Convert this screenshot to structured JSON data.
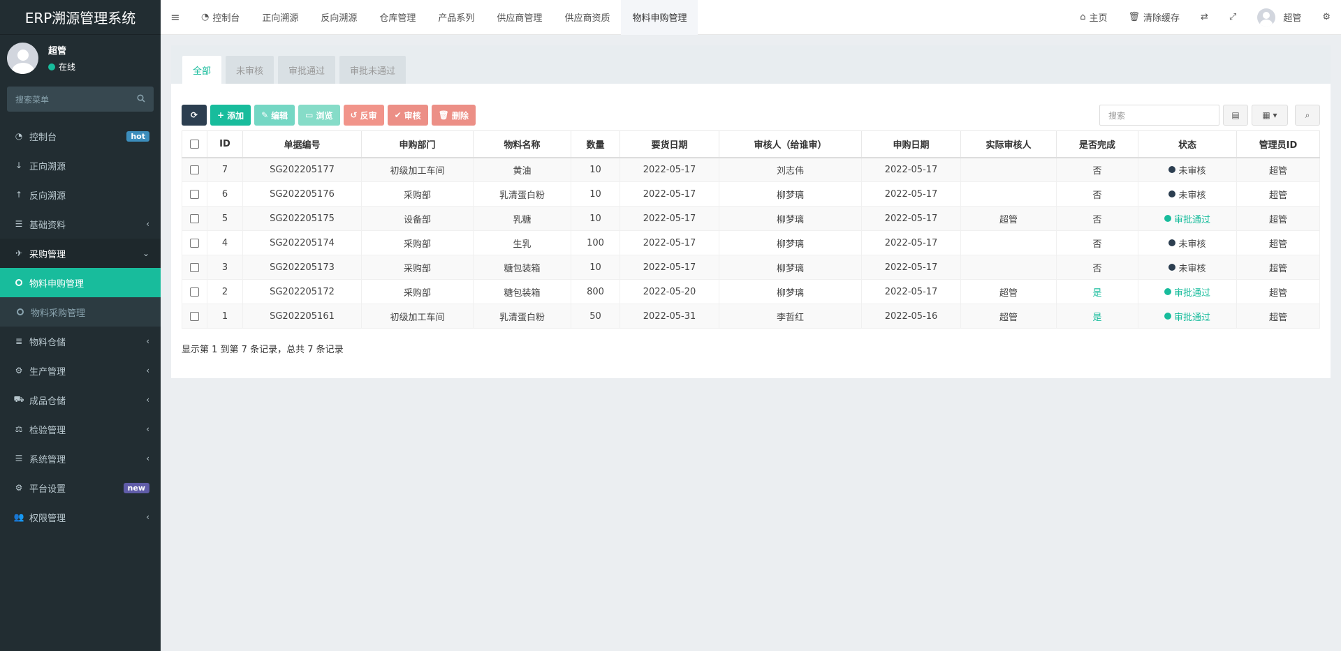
{
  "brand": "ERP溯源管理系统",
  "user": {
    "name": "超管",
    "status": "在线"
  },
  "sidebar": {
    "search_placeholder": "搜索菜单",
    "items": [
      {
        "label": "控制台",
        "icon": "dashboard-icon",
        "badge": "hot"
      },
      {
        "label": "正向溯源",
        "icon": "arrow-down-icon"
      },
      {
        "label": "反向溯源",
        "icon": "arrow-up-icon"
      },
      {
        "label": "基础资料",
        "icon": "list-icon"
      },
      {
        "label": "采购管理",
        "icon": "plane-icon"
      },
      {
        "label": "物料申购管理",
        "icon": "circle-icon"
      },
      {
        "label": "物料采购管理",
        "icon": "circle-icon"
      },
      {
        "label": "物料仓储",
        "icon": "database-icon"
      },
      {
        "label": "生产管理",
        "icon": "cogs-icon"
      },
      {
        "label": "成品仓储",
        "icon": "road-icon"
      },
      {
        "label": "检验管理",
        "icon": "balance-icon"
      },
      {
        "label": "系统管理",
        "icon": "list-icon"
      },
      {
        "label": "平台设置",
        "icon": "cogs-icon",
        "badge": "new"
      },
      {
        "label": "权限管理",
        "icon": "users-icon"
      }
    ]
  },
  "topnav": {
    "tabs": [
      "控制台",
      "正向溯源",
      "反向溯源",
      "仓库管理",
      "产品系列",
      "供应商管理",
      "供应商资质",
      "物料申购管理"
    ],
    "home": "主页",
    "clear_cache": "清除缓存",
    "username": "超管"
  },
  "panel_tabs": [
    "全部",
    "未审核",
    "审批通过",
    "审批未通过"
  ],
  "toolbar": {
    "add": "添加",
    "edit": "编辑",
    "browse": "浏览",
    "unreview": "反审",
    "review": "审核",
    "delete": "删除",
    "search_placeholder": "搜索"
  },
  "table": {
    "columns": [
      "ID",
      "单据编号",
      "申购部门",
      "物料名称",
      "数量",
      "要货日期",
      "审核人（给谁审）",
      "申购日期",
      "实际审核人",
      "是否完成",
      "状态",
      "管理员ID"
    ],
    "rows": [
      [
        "7",
        "SG202205177",
        "初级加工车间",
        "黄油",
        "10",
        "2022-05-17",
        "刘志伟",
        "2022-05-17",
        "",
        "否",
        "未审核",
        "超管"
      ],
      [
        "6",
        "SG202205176",
        "采购部",
        "乳清蛋白粉",
        "10",
        "2022-05-17",
        "柳梦璃",
        "2022-05-17",
        "",
        "否",
        "未审核",
        "超管"
      ],
      [
        "5",
        "SG202205175",
        "设备部",
        "乳糖",
        "10",
        "2022-05-17",
        "柳梦璃",
        "2022-05-17",
        "超管",
        "否",
        "审批通过",
        "超管"
      ],
      [
        "4",
        "SG202205174",
        "采购部",
        "生乳",
        "100",
        "2022-05-17",
        "柳梦璃",
        "2022-05-17",
        "",
        "否",
        "未审核",
        "超管"
      ],
      [
        "3",
        "SG202205173",
        "采购部",
        "糖包装箱",
        "10",
        "2022-05-17",
        "柳梦璃",
        "2022-05-17",
        "",
        "否",
        "未审核",
        "超管"
      ],
      [
        "2",
        "SG202205172",
        "采购部",
        "糖包装箱",
        "800",
        "2022-05-20",
        "柳梦璃",
        "2022-05-17",
        "超管",
        "是",
        "审批通过",
        "超管"
      ],
      [
        "1",
        "SG202205161",
        "初级加工车间",
        "乳清蛋白粉",
        "50",
        "2022-05-31",
        "李哲红",
        "2022-05-16",
        "超管",
        "是",
        "审批通过",
        "超管"
      ]
    ]
  },
  "footer": "显示第 1 到第 7 条记录，总共 7 条记录",
  "colors": {
    "accent": "#18bc9c",
    "sidebar": "#222d32",
    "dark": "#2c3e50"
  }
}
